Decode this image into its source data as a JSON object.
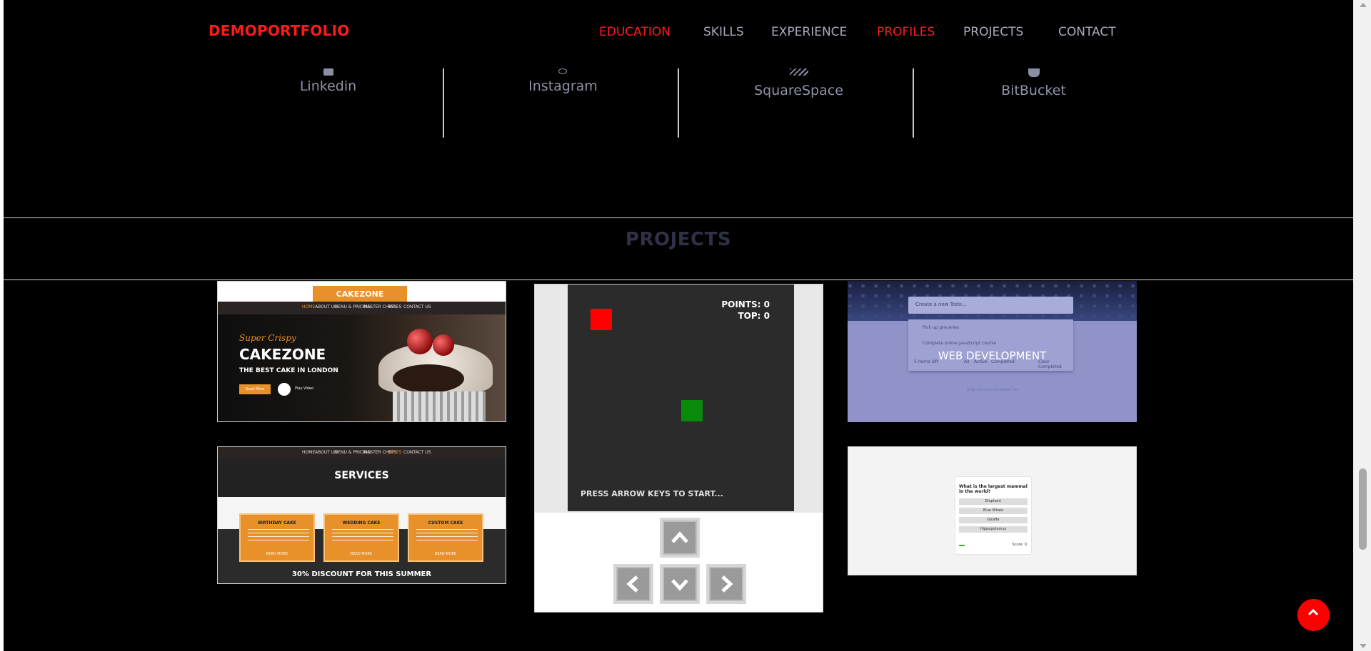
{
  "brand": "DEMOPORTFOLIO",
  "nav": {
    "items": [
      {
        "label": "EDUCATION",
        "active": true
      },
      {
        "label": "SKILLS",
        "active": false
      },
      {
        "label": "EXPERIENCE",
        "active": false
      },
      {
        "label": "PROFILES",
        "active": true
      },
      {
        "label": "PROJECTS",
        "active": false
      },
      {
        "label": "CONTACT",
        "active": false
      }
    ]
  },
  "profiles": {
    "items": [
      {
        "label": "Linkedin",
        "icon": "linkedin-icon"
      },
      {
        "label": "Instagram",
        "icon": "instagram-icon"
      },
      {
        "label": "SquareSpace",
        "icon": "squarespace-icon"
      },
      {
        "label": "BitBucket",
        "icon": "bitbucket-icon"
      }
    ]
  },
  "projects": {
    "title": "PROJECTS",
    "cakezone": {
      "logo": "CAKEZONE",
      "menu": [
        "HOME",
        "ABOUT US",
        "MENU & PRICING",
        "MASTER CHEFS",
        "PAGES",
        "CONTACT US"
      ],
      "tagline": "Super Crispy",
      "heading": "CAKEZONE",
      "subheading": "THE BEST CAKE IN LONDON",
      "button": "Read More",
      "play": "Play Video"
    },
    "services": {
      "menu": [
        "HOME",
        "ABOUT US",
        "MENU & PRICING",
        "MASTER CHEFS",
        "PAGES",
        "CONTACT US"
      ],
      "title": "SERVICES",
      "boxes": [
        {
          "title": "BIRTHDAY CAKE",
          "more": "READ MORE"
        },
        {
          "title": "WEDDING CAKE",
          "more": "READ MORE"
        },
        {
          "title": "CUSTOM CAKE",
          "more": "READ MORE"
        }
      ],
      "discount": "30% DISCOUNT FOR THIS SUMMER"
    },
    "game": {
      "points_label": "POINTS: 0",
      "top_label": "TOP: 0",
      "prompt": "PRESS ARROW KEYS TO START..."
    },
    "todo": {
      "input_placeholder": "Create a new Todo...",
      "items": [
        "Pick up groceries",
        "Complete online JavaScript course"
      ],
      "overlay": "WEB DEVELOPMENT",
      "footer_left": "5 items left",
      "filters": [
        "All",
        "Active",
        "Completed"
      ],
      "clear": "Clear Completed",
      "hint": "Drag and drop to reorder list"
    },
    "quiz": {
      "question": "What is the largest mammal in the world?",
      "options": [
        "Elephant",
        "Blue Whale",
        "Giraffe",
        "Hippopotamus"
      ],
      "score": "Score: 0"
    }
  },
  "colors": {
    "accent": "#ff1a1a",
    "nav_text": "#a8abb8",
    "background": "#000000"
  }
}
